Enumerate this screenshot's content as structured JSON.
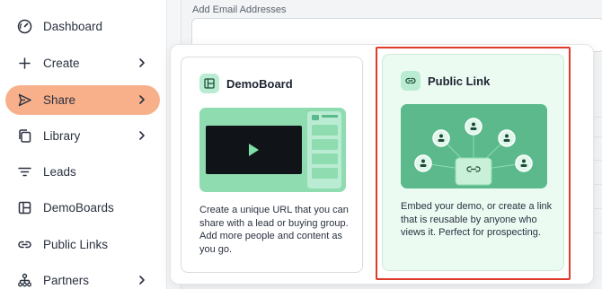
{
  "sidebar": {
    "items": [
      {
        "label": "Dashboard",
        "icon": "gauge-icon",
        "has_chevron": false
      },
      {
        "label": "Create",
        "icon": "plus-icon",
        "has_chevron": true
      },
      {
        "label": "Share",
        "icon": "send-icon",
        "has_chevron": true,
        "active": true
      },
      {
        "label": "Library",
        "icon": "copy-icon",
        "has_chevron": true
      },
      {
        "label": "Leads",
        "icon": "filter-lines-icon",
        "has_chevron": false
      },
      {
        "label": "DemoBoards",
        "icon": "layout-icon",
        "has_chevron": false
      },
      {
        "label": "Public Links",
        "icon": "link-icon",
        "has_chevron": false
      },
      {
        "label": "Partners",
        "icon": "org-chart-icon",
        "has_chevron": true
      }
    ]
  },
  "main": {
    "email_label": "Add Email Addresses"
  },
  "popup": {
    "demoboard": {
      "title": "DemoBoard",
      "description": "Create a unique URL that you can share with a lead or buying group. Add more people and content as you go."
    },
    "public_link": {
      "title": "Public Link",
      "description": "Embed your demo, or create a link that is reusable by anyone who views it. Perfect for prospecting."
    }
  },
  "colors": {
    "active_nav": "#f8b08b",
    "highlight_border": "#e03a2b",
    "illustration_green": "#5bb98c",
    "icon_badge": "#b9ecd2"
  }
}
